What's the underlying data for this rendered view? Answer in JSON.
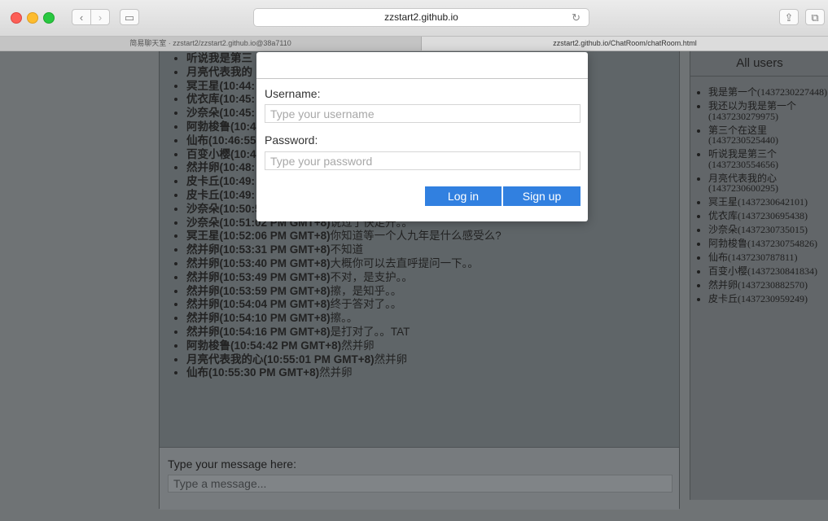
{
  "browser": {
    "url": "zzstart2.github.io",
    "tabs": [
      {
        "label": "简易聊天室 · zzstart2/zzstart2.github.io@38a7110"
      },
      {
        "label": "zzstart2.github.io/ChatRoom/chatRoom.html"
      }
    ],
    "icons": {
      "back": "‹",
      "forward": "›",
      "sidebar": "▭",
      "reload": "↻",
      "share": "⇪",
      "tabs": "⧉"
    }
  },
  "chat": {
    "messages": [
      {
        "name": "听说我是第三",
        "time": "",
        "text": ""
      },
      {
        "name": "月亮代表我的",
        "time": "",
        "text": ""
      },
      {
        "name": "冥王星",
        "time": "(10:44:",
        "text": ""
      },
      {
        "name": "优衣库",
        "time": "(10:45:",
        "text": ""
      },
      {
        "name": "沙奈朵",
        "time": "(10:45:",
        "text": ""
      },
      {
        "name": "阿勃梭鲁",
        "time": "(10:4",
        "text": ""
      },
      {
        "name": "仙布",
        "time": "(10:46:55",
        "text": ""
      },
      {
        "name": "百变小樱",
        "time": "(10:4",
        "text": ""
      },
      {
        "name": "然并卵",
        "time": "(10:48:",
        "text": ""
      },
      {
        "name": "皮卡丘",
        "time": "(10:49:",
        "text": ""
      },
      {
        "name": "皮卡丘",
        "time": "(10:49:",
        "text": ""
      },
      {
        "name": "沙奈朵",
        "time": "(10:50:54 PM GMT+8)",
        "text": "走开。。"
      },
      {
        "name": "沙奈朵",
        "time": "(10:51:02 PM GMT+8)",
        "text": "说过了快走开。。"
      },
      {
        "name": "冥王星",
        "time": "(10:52:06 PM GMT+8)",
        "text": "你知道等一个人九年是什么感受么?"
      },
      {
        "name": "然并卵",
        "time": "(10:53:31 PM GMT+8)",
        "text": "不知道"
      },
      {
        "name": "然并卵",
        "time": "(10:53:40 PM GMT+8)",
        "text": "大概你可以去直呼提问一下。。"
      },
      {
        "name": "然并卵",
        "time": "(10:53:49 PM GMT+8)",
        "text": "不对，是支护。。"
      },
      {
        "name": "然并卵",
        "time": "(10:53:59 PM GMT+8)",
        "text": "擦，是知乎。。"
      },
      {
        "name": "然并卵",
        "time": "(10:54:04 PM GMT+8)",
        "text": "终于答对了。。"
      },
      {
        "name": "然并卵",
        "time": "(10:54:10 PM GMT+8)",
        "text": "擦。。"
      },
      {
        "name": "然并卵",
        "time": "(10:54:16 PM GMT+8)",
        "text": "是打对了。。TAT"
      },
      {
        "name": "阿勃梭鲁",
        "time": "(10:54:42 PM GMT+8)",
        "text": "然并卵"
      },
      {
        "name": "月亮代表我的心",
        "time": "(10:55:01 PM GMT+8)",
        "text": "然并卵"
      },
      {
        "name": "仙布",
        "time": "(10:55:30 PM GMT+8)",
        "text": "然并卵"
      }
    ],
    "input_label": "Type your message here:",
    "input_placeholder": "Type a message..."
  },
  "users": {
    "title": "All users",
    "list": [
      "我是第一个(1437230227448)",
      "我还以为我是第一个(1437230279975)",
      "第三个在这里(1437230525440)",
      "听说我是第三个(1437230554656)",
      "月亮代表我的心(1437230600295)",
      "冥王星(1437230642101)",
      "优衣库(1437230695438)",
      "沙奈朵(1437230735015)",
      "阿勃梭鲁(1437230754826)",
      "仙布(1437230787811)",
      "百变小樱(1437230841834)",
      "然并卵(1437230882570)",
      "皮卡丘(1437230959249)"
    ]
  },
  "modal": {
    "username_label": "Username:",
    "username_placeholder": "Type your username",
    "password_label": "Password:",
    "password_placeholder": "Type your password",
    "login_label": "Log in",
    "signup_label": "Sign up",
    "button_color": "#3180e0"
  }
}
